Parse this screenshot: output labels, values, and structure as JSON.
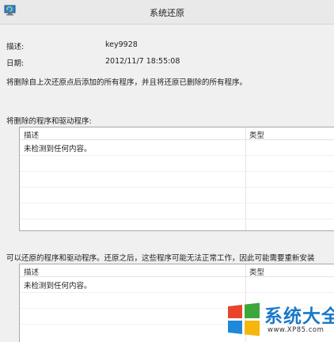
{
  "window": {
    "title": "系统还原"
  },
  "details": {
    "description_label": "描述:",
    "description_value": "key9928",
    "date_label": "日期:",
    "date_value": "2012/11/7 18:55:08",
    "summary": "将删除自上次还原点后添加的所有程序，并且将还原已删除的所有程序。"
  },
  "deleted_section": {
    "label": "将删除的程序和驱动程序:",
    "columns": [
      "描述",
      "类型"
    ],
    "empty_message": "未检测到任何内容。"
  },
  "restored_section": {
    "label": "可以还原的程序和驱动程序。还原之后，这些程序可能无法正常工作，因此可能需要重新安装",
    "columns": [
      "描述",
      "类型"
    ],
    "empty_message": "未检测到任何内容。"
  },
  "watermark": {
    "name": "系统大全",
    "url": "www.XP85.com",
    "logo_colors": [
      "#e8452c",
      "#3aa83a",
      "#1e88d9",
      "#f6b60c"
    ]
  }
}
